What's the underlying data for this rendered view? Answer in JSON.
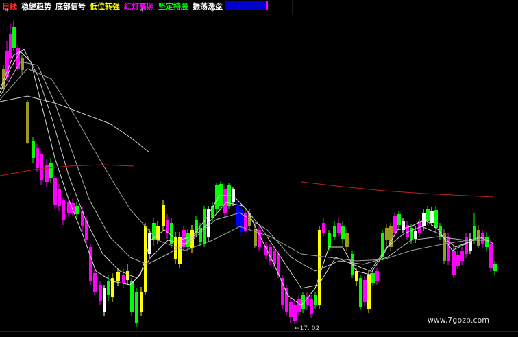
{
  "legend": [
    {
      "label": "日线",
      "color": "#ff3030"
    },
    {
      "label": "稳健趋势",
      "color": "#ffffff"
    },
    {
      "label": "底部信号",
      "color": "#ffffff"
    },
    {
      "label": "低位转强",
      "color": "#ffff00"
    },
    {
      "label": "红灯高照",
      "color": "#ff00ff"
    },
    {
      "label": "坚定持股",
      "color": "#00ff00"
    },
    {
      "label": "振荡洗盘",
      "color": "#ffffff"
    },
    {
      "label": "",
      "color": "#0000ff"
    }
  ],
  "markers": [
    "*",
    "*",
    "*",
    "*"
  ],
  "watermark": "www.7gpzb.com",
  "date_label": "←17. 02",
  "colors": {
    "yellow": "#ffff00",
    "magenta": "#ff00ff",
    "green": "#00ff00",
    "white": "#ffffff",
    "olive": "#9a9a20",
    "blue": "#0000ff",
    "red": "#ff2020"
  }
}
